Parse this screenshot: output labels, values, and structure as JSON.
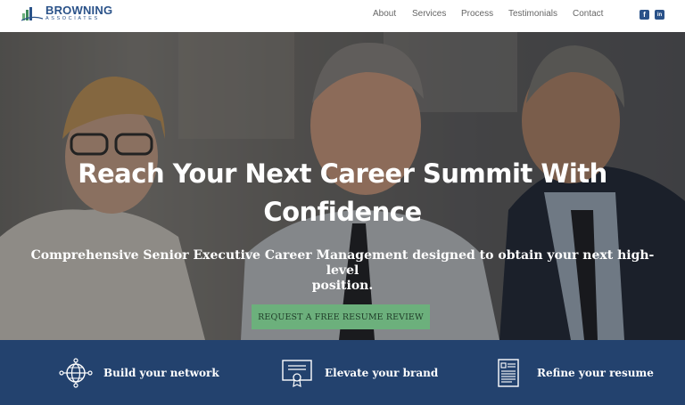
{
  "brand": {
    "name": "BROWNING",
    "sub": "ASSOCIATES"
  },
  "nav": {
    "items": [
      "About",
      "Services",
      "Process",
      "Testimonials",
      "Contact"
    ]
  },
  "social": {
    "facebook": "f",
    "linkedin": "in"
  },
  "hero": {
    "headline_line1": "Reach Your Next Career Summit With",
    "headline_line2": "Confidence",
    "subhead_line1": "Comprehensive Senior Executive Career Management designed to obtain your next high-level",
    "subhead_line2": "position.",
    "cta_label": "REQUEST A FREE RESUME REVIEW"
  },
  "features": [
    {
      "icon": "globe-network-icon",
      "label": "Build your network"
    },
    {
      "icon": "certificate-icon",
      "label": "Elevate your brand"
    },
    {
      "icon": "resume-document-icon",
      "label": "Refine your resume"
    }
  ],
  "colors": {
    "brand_blue": "#2a5289",
    "band_navy": "#23426e",
    "cta_green": "#6cb07c"
  }
}
